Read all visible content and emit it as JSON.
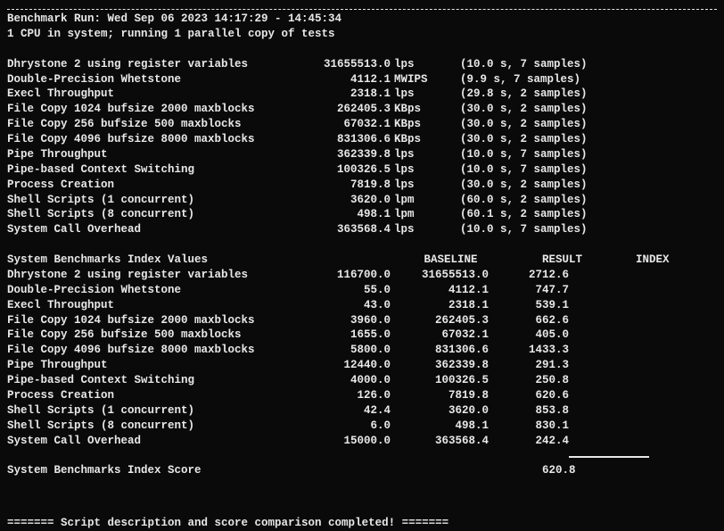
{
  "header": {
    "separator": "========================================================================",
    "run_line": "Benchmark Run: Wed Sep 06 2023 14:17:29 - 14:45:34",
    "cpu_line": "1 CPU in system; running 1 parallel copy of tests"
  },
  "results": [
    {
      "name": "Dhrystone 2 using register variables",
      "value": "31655513.0",
      "unit": "lps",
      "note": "(10.0 s, 7 samples)"
    },
    {
      "name": "Double-Precision Whetstone",
      "value": "4112.1",
      "unit": "MWIPS",
      "note": "(9.9 s, 7 samples)"
    },
    {
      "name": "Execl Throughput",
      "value": "2318.1",
      "unit": "lps",
      "note": "(29.8 s, 2 samples)"
    },
    {
      "name": "File Copy 1024 bufsize 2000 maxblocks",
      "value": "262405.3",
      "unit": "KBps",
      "note": "(30.0 s, 2 samples)"
    },
    {
      "name": "File Copy 256 bufsize 500 maxblocks",
      "value": "67032.1",
      "unit": "KBps",
      "note": "(30.0 s, 2 samples)"
    },
    {
      "name": "File Copy 4096 bufsize 8000 maxblocks",
      "value": "831306.6",
      "unit": "KBps",
      "note": "(30.0 s, 2 samples)"
    },
    {
      "name": "Pipe Throughput",
      "value": "362339.8",
      "unit": "lps",
      "note": "(10.0 s, 7 samples)"
    },
    {
      "name": "Pipe-based Context Switching",
      "value": "100326.5",
      "unit": "lps",
      "note": "(10.0 s, 7 samples)"
    },
    {
      "name": "Process Creation",
      "value": "7819.8",
      "unit": "lps",
      "note": "(30.0 s, 2 samples)"
    },
    {
      "name": "Shell Scripts (1 concurrent)",
      "value": "3620.0",
      "unit": "lpm",
      "note": "(60.0 s, 2 samples)"
    },
    {
      "name": "Shell Scripts (8 concurrent)",
      "value": "498.1",
      "unit": "lpm",
      "note": "(60.1 s, 2 samples)"
    },
    {
      "name": "System Call Overhead",
      "value": "363568.4",
      "unit": "lps",
      "note": "(10.0 s, 7 samples)"
    }
  ],
  "index_header": {
    "title": "System Benchmarks Index Values",
    "baseline": "BASELINE",
    "result": "RESULT",
    "index": "INDEX"
  },
  "index_rows": [
    {
      "name": "Dhrystone 2 using register variables",
      "baseline": "116700.0",
      "result": "31655513.0",
      "index": "2712.6"
    },
    {
      "name": "Double-Precision Whetstone",
      "baseline": "55.0",
      "result": "4112.1",
      "index": "747.7"
    },
    {
      "name": "Execl Throughput",
      "baseline": "43.0",
      "result": "2318.1",
      "index": "539.1"
    },
    {
      "name": "File Copy 1024 bufsize 2000 maxblocks",
      "baseline": "3960.0",
      "result": "262405.3",
      "index": "662.6"
    },
    {
      "name": "File Copy 256 bufsize 500 maxblocks",
      "baseline": "1655.0",
      "result": "67032.1",
      "index": "405.0"
    },
    {
      "name": "File Copy 4096 bufsize 8000 maxblocks",
      "baseline": "5800.0",
      "result": "831306.6",
      "index": "1433.3"
    },
    {
      "name": "Pipe Throughput",
      "baseline": "12440.0",
      "result": "362339.8",
      "index": "291.3"
    },
    {
      "name": "Pipe-based Context Switching",
      "baseline": "4000.0",
      "result": "100326.5",
      "index": "250.8"
    },
    {
      "name": "Process Creation",
      "baseline": "126.0",
      "result": "7819.8",
      "index": "620.6"
    },
    {
      "name": "Shell Scripts (1 concurrent)",
      "baseline": "42.4",
      "result": "3620.0",
      "index": "853.8"
    },
    {
      "name": "Shell Scripts (8 concurrent)",
      "baseline": "6.0",
      "result": "498.1",
      "index": "830.1"
    },
    {
      "name": "System Call Overhead",
      "baseline": "15000.0",
      "result": "363568.4",
      "index": "242.4"
    }
  ],
  "score": {
    "label": "System Benchmarks Index Score",
    "value": "620.8"
  },
  "footer": {
    "line": "======= Script description and score comparison completed! ======="
  }
}
